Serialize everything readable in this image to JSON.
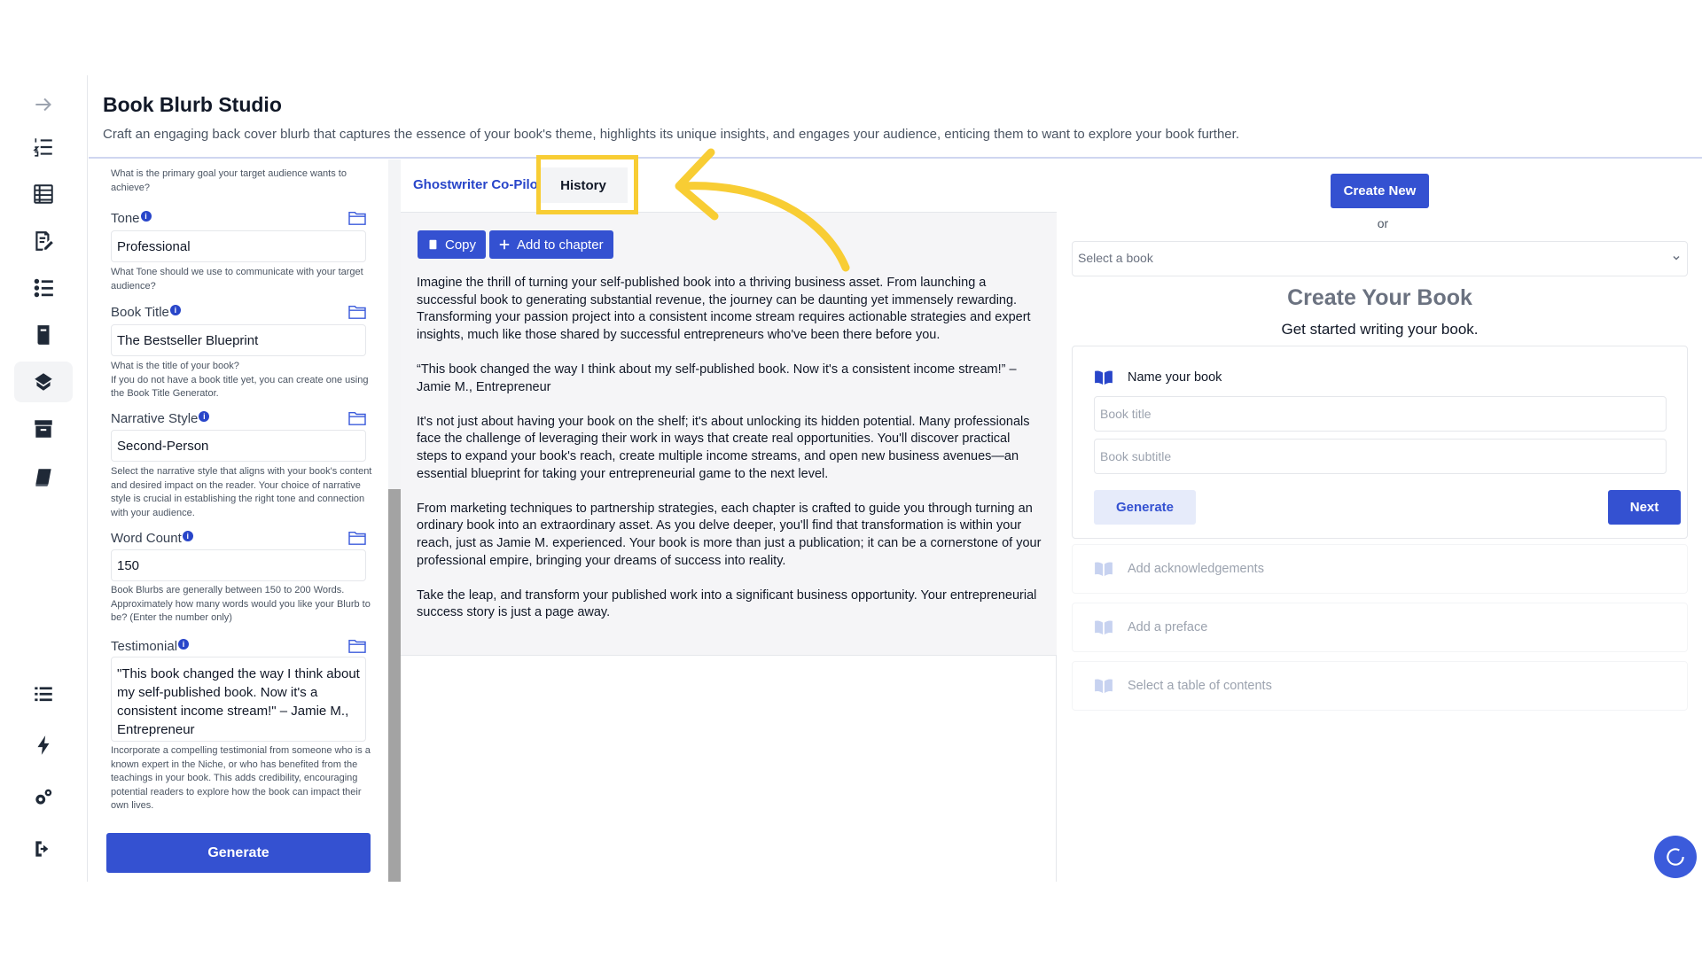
{
  "app": {
    "title": "Book Blurb Studio",
    "subtitle": "Craft an engaging back cover blurb that captures the essence of your book's theme, highlights its unique insights, and engages your audience, enticing them to want to explore your book further."
  },
  "sidebar": {
    "items": [
      {
        "name": "arrow-right-icon"
      },
      {
        "name": "numbered-list-icon"
      },
      {
        "name": "table-icon"
      },
      {
        "name": "edit-document-icon"
      },
      {
        "name": "checklist-icon"
      },
      {
        "name": "book-open-icon"
      },
      {
        "name": "book-tag-icon",
        "active": true
      },
      {
        "name": "archive-icon"
      },
      {
        "name": "book-icon"
      },
      {
        "name": "list-icon"
      },
      {
        "name": "bolt-icon"
      },
      {
        "name": "gears-icon"
      },
      {
        "name": "logout-icon"
      }
    ]
  },
  "form": {
    "top_help": "What is the primary goal your target audience wants to achieve?",
    "fields": [
      {
        "label": "Tone",
        "value": "Professional",
        "help": "What Tone should we use to communicate with your target audience?"
      },
      {
        "label": "Book Title",
        "value": "The Bestseller Blueprint",
        "help": "What is the title of your book?\nIf you do not have a book title yet, you can create one using the Book Title Generator."
      },
      {
        "label": "Narrative Style",
        "value": "Second-Person",
        "help": "Select the narrative style that aligns with your book's content and desired impact on the reader. Your choice of narrative style is crucial in establishing the right tone and connection with your audience."
      },
      {
        "label": "Word Count",
        "value": "150",
        "help": "Book Blurbs are generally between 150 to 200 Words. Approximately how many words would you like your Blurb to be? (Enter the number only)"
      },
      {
        "label": "Testimonial",
        "value": "\"This book changed the way I think about my self-published book. Now it's a consistent income stream!\" – Jamie M., Entrepreneur",
        "help": "Incorporate a compelling testimonial from someone who is a known expert in the Niche, or who has benefited from the teachings in your book. This adds credibility, encouraging potential readers to explore how the book can impact their own lives."
      }
    ],
    "generate_label": "Generate"
  },
  "middle": {
    "tabs": [
      {
        "label": "Ghostwriter Co-Pilot"
      },
      {
        "label": "History"
      }
    ],
    "copy_label": "Copy",
    "add_chapter_label": "Add to chapter",
    "blurb": [
      "Imagine the thrill of turning your self-published book into a thriving business asset. From launching a successful book to generating substantial revenue, the journey can be daunting yet immensely rewarding. Transforming your passion project into a consistent income stream requires actionable strategies and expert insights, much like those shared by successful entrepreneurs who've been there before you.",
      "“This book changed the way I think about my self-published book. Now it's a consistent income stream!” – Jamie M., Entrepreneur",
      "It's not just about having your book on the shelf; it's about unlocking its hidden potential. Many professionals face the challenge of leveraging their work in ways that create real opportunities. You'll discover practical steps to expand your book's reach, create multiple income streams, and open new business avenues—an essential blueprint for taking your entrepreneurial game to the next level.",
      "From marketing techniques to partnership strategies, each chapter is crafted to guide you through turning an ordinary book into an extraordinary asset. As you delve deeper, you'll find that transformation is within your reach, just as Jamie M. experienced. Your book is more than just a publication; it can be a cornerstone of your professional empire, bringing your dreams of success into reality.",
      "Take the leap, and transform your published work into a significant business opportunity. Your entrepreneurial success story is just a page away."
    ]
  },
  "right": {
    "create_new_label": "Create New",
    "or_label": "or",
    "select_placeholder": "Select a book",
    "create_title": "Create Your Book",
    "create_sub": "Get started writing your book.",
    "step_name": "Name your book",
    "book_title_placeholder": "Book title",
    "book_subtitle_placeholder": "Book subtitle",
    "generate_label": "Generate",
    "next_label": "Next",
    "steps_disabled": [
      {
        "label": "Add acknowledgements"
      },
      {
        "label": "Add a preface"
      },
      {
        "label": "Select a table of contents"
      }
    ]
  },
  "colors": {
    "accent": "#3451d1",
    "highlight": "#f8cd34"
  }
}
